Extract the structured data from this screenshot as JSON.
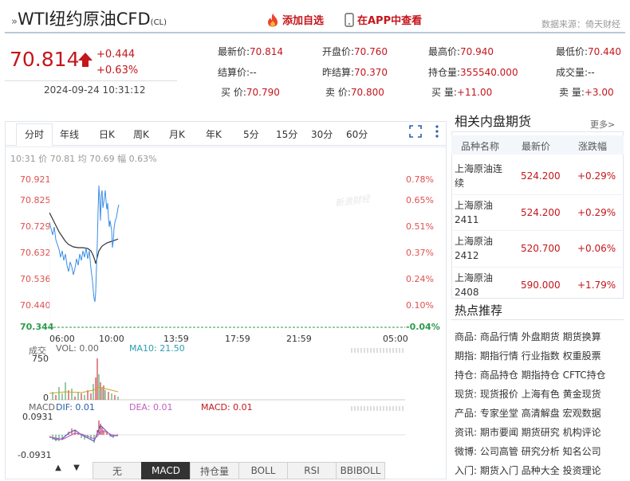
{
  "header": {
    "title": "WTI纽约原油CFD",
    "ticker": "(CL)",
    "add_watch": "添加自选",
    "open_app": "在APP中查看",
    "source": "数据来源：倚天财经"
  },
  "price": {
    "last": "70.814",
    "change": "+0.444",
    "change_pct": "+0.63%",
    "datetime": "2024-09-24 10:31:12"
  },
  "quote": {
    "last_label": "最新价:",
    "last": "70.814",
    "open_label": "开盘价:",
    "open": "70.760",
    "high_label": "最高价:",
    "high": "70.940",
    "low_label": "最低价:",
    "low": "70.440",
    "settle_label": "结算价:",
    "settle": "--",
    "prev_settle_label": "昨结算:",
    "prev_settle": "70.370",
    "oi_label": "持仓量:",
    "oi": "355540.000",
    "vol_label": "成交量:",
    "vol": "--",
    "bid_label": "买  价:",
    "bid": "70.790",
    "ask_label": "卖  价:",
    "ask": "70.800",
    "bid_qty_label": "买  量:",
    "bid_qty": "+11.00",
    "ask_qty_label": "卖  量:",
    "ask_qty": "+3.00"
  },
  "chart": {
    "tabs": [
      "分时",
      "年线",
      "日K",
      "周K",
      "月K",
      "年K",
      "5分",
      "15分",
      "30分",
      "60分"
    ],
    "info": "10:31 价 70.81 均 70.69 幅 0.63%",
    "y_labels": [
      "70.921",
      "70.825",
      "70.729",
      "70.632",
      "70.536",
      "70.440",
      "70.344"
    ],
    "pct_labels": [
      "0.78%",
      "0.65%",
      "0.51%",
      "0.37%",
      "0.24%",
      "0.10%",
      "-0.04%"
    ],
    "x_labels": [
      "06:00",
      "10:00",
      "13:59",
      "17:59",
      "21:59",
      "05:00"
    ],
    "vol_header_label": "成交",
    "vol_label": "VOL: 0.00",
    "ma10_label": "MA10: 21.50",
    "vol_max": "750",
    "vol_min": "0",
    "macd_label": "MACD",
    "dif_label": "DIF: 0.01",
    "dea_label": "DEA: 0.01",
    "macd_val_label": "MACD: 0.01",
    "macd_max": "0.0931",
    "macd_min": "-0.0931",
    "watermark": "新浪财经",
    "bottom_tabs": [
      "无",
      "MACD",
      "持仓量",
      "BOLL",
      "RSI",
      "BBIBOLL"
    ],
    "active_bottom": "MACD",
    "colors": {
      "price_line": "#3a8ee6",
      "avg_line": "#333333",
      "up": "#c4161c",
      "macd_pos": "#c4161c",
      "macd_neg": "#2e9b4e",
      "dif": "#c060c0",
      "dea": "#6060c0"
    }
  },
  "related": {
    "title": "相关内盘期货",
    "more": "更多>",
    "columns": [
      "品种名称",
      "最新价",
      "涨跌幅"
    ],
    "rows": [
      {
        "name": "上海原油连续",
        "price": "524.200",
        "pct": "+0.29%"
      },
      {
        "name": "上海原油2411",
        "price": "524.200",
        "pct": "+0.29%"
      },
      {
        "name": "上海原油2412",
        "price": "520.700",
        "pct": "+0.06%"
      },
      {
        "name": "上海原油2408",
        "price": "590.000",
        "pct": "+1.79%"
      }
    ]
  },
  "hot": {
    "title": "热点推荐",
    "rows": [
      {
        "k": "商品:",
        "items": [
          "商品行情",
          "外盘期货",
          "期货换算"
        ]
      },
      {
        "k": "期指:",
        "items": [
          "期指行情",
          "行业指数",
          "权重股票"
        ]
      },
      {
        "k": "持仓:",
        "items": [
          "商品持仓",
          "期指持仓",
          "CFTC持仓"
        ]
      },
      {
        "k": "现货:",
        "items": [
          "现货报价",
          "上海有色",
          "黄金现货"
        ]
      },
      {
        "k": "产品:",
        "items": [
          "专家坐堂",
          "高清解盘",
          "宏观数据"
        ]
      },
      {
        "k": "资讯:",
        "items": [
          "期市要闻",
          "期货研究",
          "机构评论"
        ]
      },
      {
        "k": "微博:",
        "items": [
          "公司高管",
          "研究分析",
          "知名公司"
        ]
      },
      {
        "k": "入门:",
        "items": [
          "期货入门",
          "品种大全",
          "投资理论"
        ]
      }
    ]
  }
}
